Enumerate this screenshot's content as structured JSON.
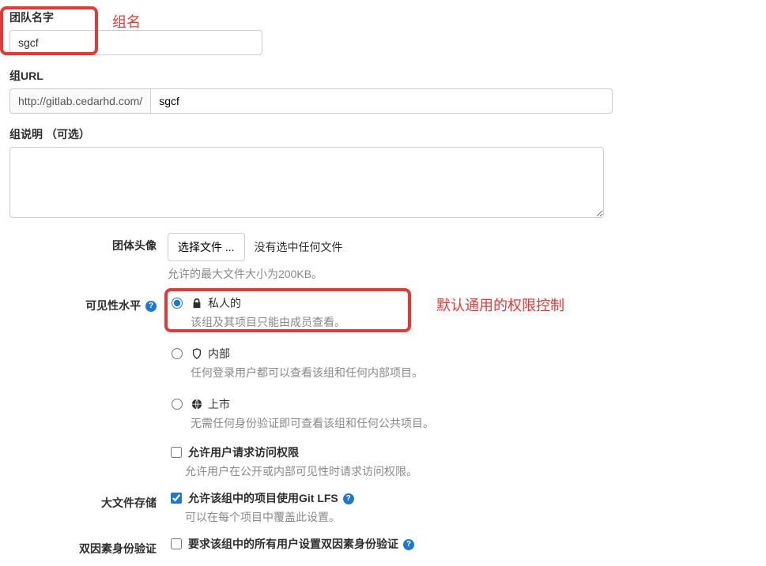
{
  "team_name": {
    "label": "团队名字",
    "value": "sgcf",
    "annotation": "组名"
  },
  "group_url": {
    "label": "组URL",
    "prefix": "http://gitlab.cedarhd.com/",
    "value": "sgcf"
  },
  "group_desc": {
    "label": "组说明 （可选）",
    "value": ""
  },
  "avatar": {
    "label": "团体头像",
    "button": "选择文件 ...",
    "status": "没有选中任何文件",
    "hint": "允许的最大文件大小为200KB。"
  },
  "visibility": {
    "label": "可见性水平",
    "annotation": "默认通用的权限控制",
    "options": [
      {
        "title": "私人的",
        "desc": "该组及其项目只能由成员查看。"
      },
      {
        "title": "内部",
        "desc": "任何登录用户都可以查看该组和任何内部项目。"
      },
      {
        "title": "上市",
        "desc": "无需任何身份验证即可查看该组和任何公共项目。"
      }
    ]
  },
  "access_request": {
    "label": "允许用户请求访问权限",
    "desc": "允许用户在公开或内部可见性时请求访问权限。"
  },
  "lfs": {
    "label": "大文件存储",
    "checkbox_label": "允许该组中的项目使用Git LFS",
    "desc": "可以在每个项目中覆盖此设置。"
  },
  "two_factor": {
    "label": "双因素身份验证",
    "checkbox_label": "要求该组中的所有用户设置双因素身份验证"
  }
}
